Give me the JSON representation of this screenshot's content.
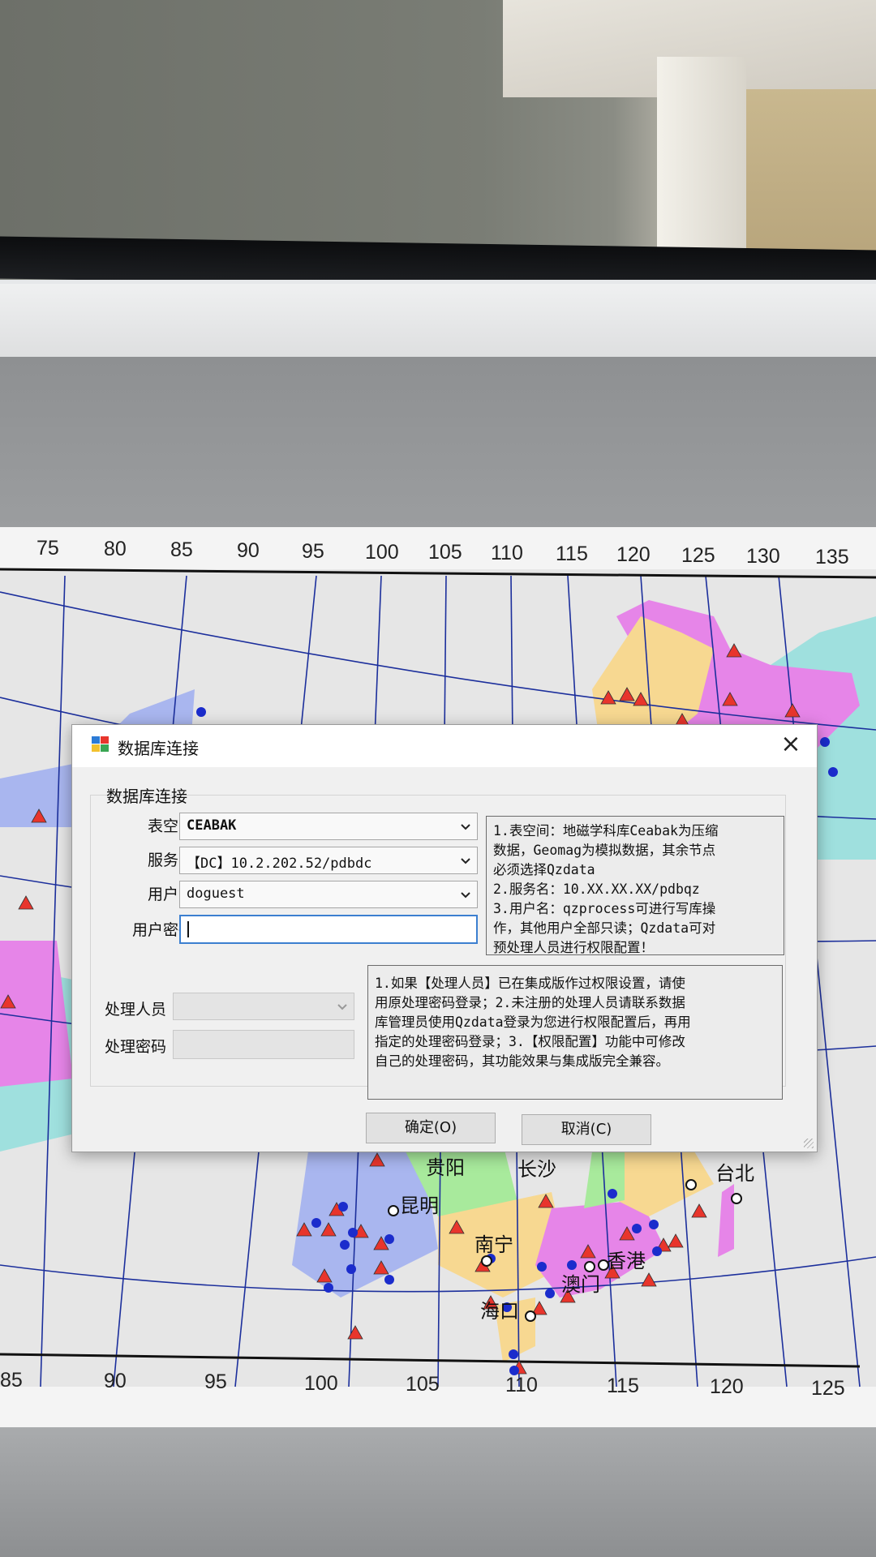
{
  "map": {
    "top_ticks": [
      "75",
      "80",
      "85",
      "90",
      "95",
      "100",
      "105",
      "110",
      "115",
      "120",
      "125",
      "130",
      "135"
    ],
    "bottom_ticks": [
      "85",
      "90",
      "95",
      "100",
      "105",
      "110",
      "115",
      "120",
      "125"
    ],
    "cities": [
      "贵阳",
      "昆明",
      "南宁",
      "海口",
      "澳门",
      "香港",
      "台北",
      "长沙"
    ],
    "colors": {
      "sea": "#9fe0de",
      "land": "#e2e2e2",
      "purple": "#e685e8",
      "orange": "#f7d891",
      "blue": "#a9b6ef",
      "green": "#a8ea9c",
      "marker_tri": "#e8352c",
      "marker_dot": "#1b2ccc"
    }
  },
  "dialog": {
    "title": "数据库连接",
    "group_label": "数据库连接",
    "fields": {
      "tablespace": {
        "label": "表空间",
        "value": "CEABAK"
      },
      "service": {
        "label": "服务名",
        "value": "【DC】10.2.202.52/pdbdc"
      },
      "username": {
        "label": "用户名",
        "value": "doguest"
      },
      "password": {
        "label": "用户密码",
        "value": ""
      },
      "processor": {
        "label": "处理人员",
        "value": ""
      },
      "processor_password": {
        "label": "处理密码",
        "value": ""
      }
    },
    "info_top": [
      "1.表空间：地磁学科库Ceabak为压缩",
      "数据，Geomag为模拟数据，其余节点",
      "必须选择Qzdata",
      "2.服务名：10.XX.XX.XX/pdbqz",
      "3.用户名：qzprocess可进行写库操",
      "作，其他用户全部只读；Qzdata可对",
      "预处理人员进行权限配置！"
    ],
    "info_bottom": [
      "1.如果【处理人员】已在集成版作过权限设置，请使",
      "用原处理密码登录；2.未注册的处理人员请联系数据",
      "库管理员使用Qzdata登录为您进行权限配置后，再用",
      "指定的处理密码登录；3.【权限配置】功能中可修改",
      "自己的处理密码，其功能效果与集成版完全兼容。"
    ],
    "ok_label": "确定(O)",
    "cancel_label": "取消(C)"
  }
}
